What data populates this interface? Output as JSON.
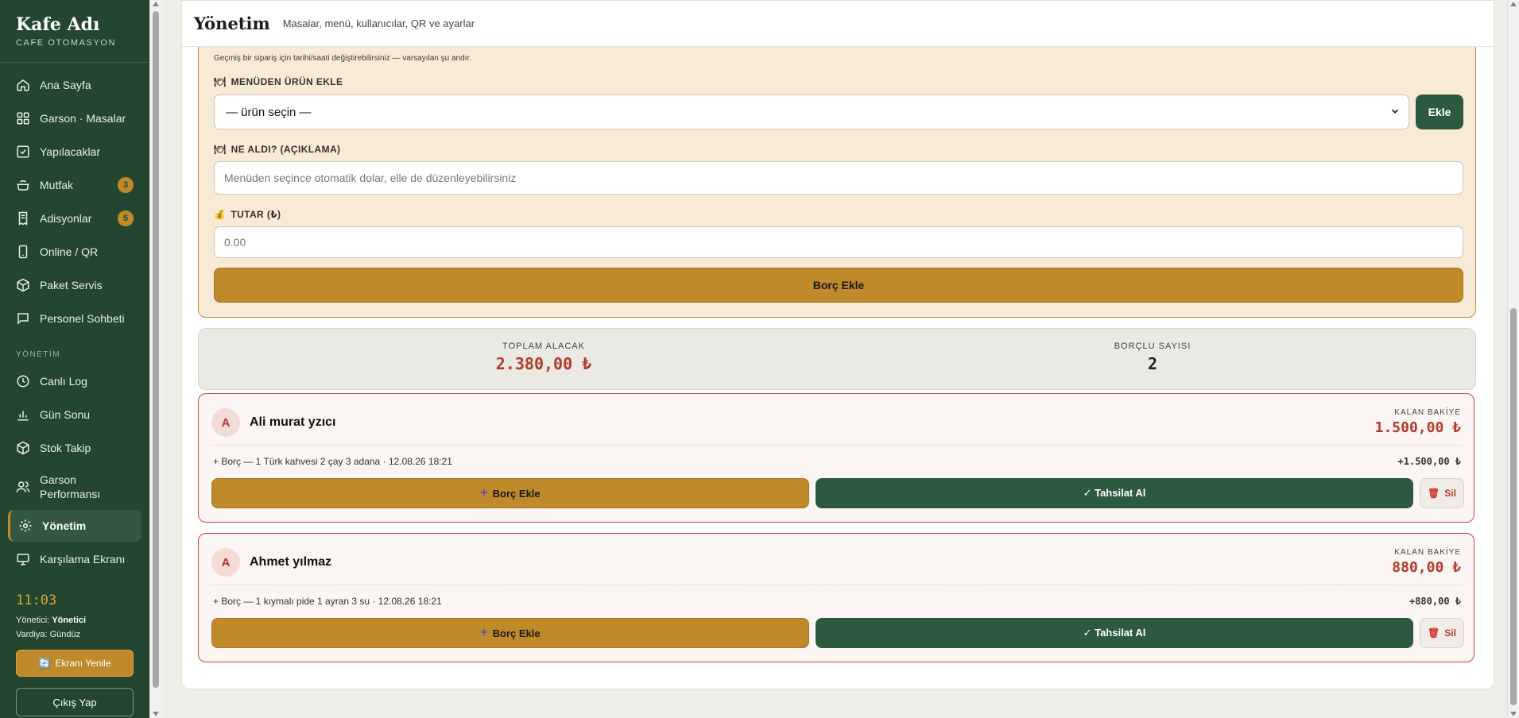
{
  "sidebar": {
    "brand_name": "Kafe Adı",
    "brand_sub": "CAFE OTOMASYON",
    "nav": [
      {
        "label": "Ana Sayfa",
        "icon": "home-icon"
      },
      {
        "label": "Garson · Masalar",
        "icon": "grid-icon"
      },
      {
        "label": "Yapılacaklar",
        "icon": "checkbox-icon"
      },
      {
        "label": "Mutfak",
        "icon": "pot-icon",
        "badge": "3"
      },
      {
        "label": "Adisyonlar",
        "icon": "receipt-icon",
        "badge": "5"
      },
      {
        "label": "Online / QR",
        "icon": "phone-icon"
      },
      {
        "label": "Paket Servis",
        "icon": "package-icon"
      },
      {
        "label": "Personel Sohbeti",
        "icon": "chat-icon"
      }
    ],
    "section_title": "YÖNETİM",
    "admin_nav": [
      {
        "label": "Canlı Log",
        "icon": "clock-icon"
      },
      {
        "label": "Gün Sonu",
        "icon": "bar-chart-icon"
      },
      {
        "label": "Stok Takip",
        "icon": "box-icon"
      },
      {
        "label": "Garson Performansı",
        "icon": "users-icon"
      },
      {
        "label": "Yönetim",
        "icon": "gear-icon",
        "active": true
      },
      {
        "label": "Karşılama Ekranı",
        "icon": "monitor-icon"
      }
    ],
    "clock": "11:03",
    "manager_label": "Yönetici:",
    "manager_value": "Yönetici",
    "shift_text": "Vardiya: Gündüz",
    "refresh_label": "Ekranı Yenile",
    "logout_label": "Çıkış Yap"
  },
  "header": {
    "title": "Yönetim",
    "subtitle": "Masalar, menü, kullanıcılar, QR ve ayarlar"
  },
  "form": {
    "hint": "Geçmiş bir sipariş için tarihi/saati değiştirebilirsiniz — varsayılan şu andır.",
    "menu_label": "MENÜDEN ÜRÜN EKLE",
    "menu_select_value": "— ürün seçin —",
    "add_button": "Ekle",
    "desc_label": "NE ALDI? (AÇIKLAMA)",
    "desc_placeholder": "Menüden seçince otomatik dolar, elle de düzenleyebilirsiniz",
    "amount_label": "TUTAR (₺)",
    "amount_placeholder": "0.00",
    "submit_button": "Borç Ekle",
    "label_icons": {
      "menu": "🍽",
      "desc": "🍽",
      "amount": "💰"
    }
  },
  "summary": {
    "total_label": "TOPLAM ALACAK",
    "total_value": "2.380,00 ₺",
    "count_label": "BORÇLU SAYISI",
    "count_value": "2"
  },
  "debtors": [
    {
      "initial": "A",
      "name": "Ali murat yzıcı",
      "balance_label": "KALAN BAKİYE",
      "balance": "1.500,00 ₺",
      "tx": "+ Borç — 1 Türk kahvesi 2 çay 3 adana · 12.08.26 18:21",
      "tx_amount": "+1.500,00 ₺",
      "add_label": "Borç Ekle",
      "pay_label": "✓ Tahsilat Al",
      "delete_label": "Sil"
    },
    {
      "initial": "A",
      "name": "Ahmet yılmaz",
      "balance_label": "KALAN BAKİYE",
      "balance": "880,00 ₺",
      "tx": "+ Borç — 1 kıymalı pide 1 ayran 3 su · 12.08.26 18:21",
      "tx_amount": "+880,00 ₺",
      "add_label": "Borç Ekle",
      "pay_label": "✓ Tahsilat Al",
      "delete_label": "Sil"
    }
  ],
  "colors": {
    "sidebar_bg": "#24452f",
    "accent_gold": "#c0892a",
    "accent_green": "#2c5a3f",
    "debt_red": "#b23b2b",
    "form_bg": "#f7ead7"
  }
}
